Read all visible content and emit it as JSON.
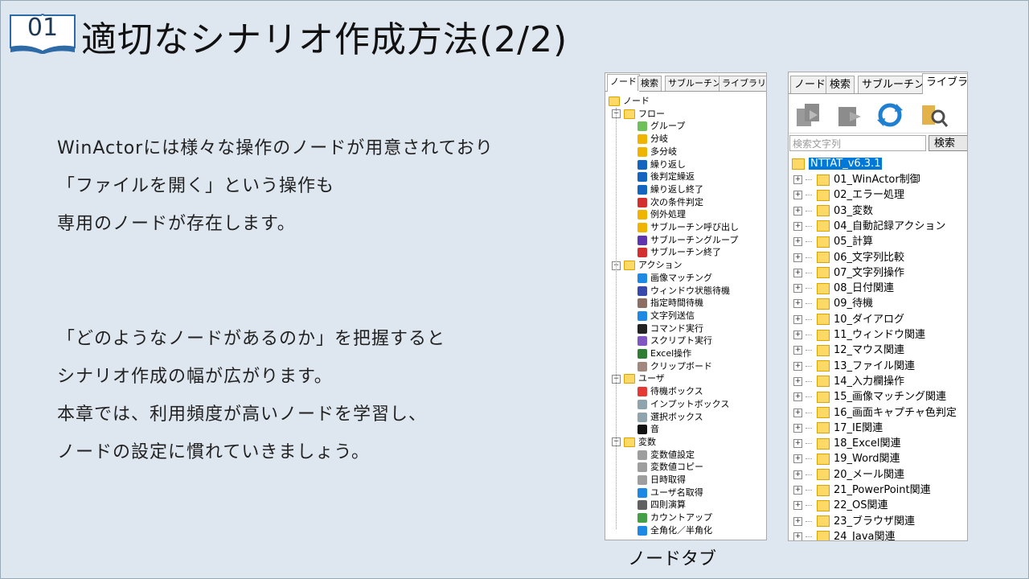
{
  "badge": {
    "number": "01"
  },
  "title": "適切なシナリオ作成方法(2/2)",
  "para1": [
    "WinActorには様々な操作のノードが用意されており",
    "「ファイルを開く」という操作も",
    "専用のノードが存在します。"
  ],
  "para2": [
    "「どのようなノードがあるのか」を把握すると",
    "シナリオ作成の幅が広がります。",
    "本章では、利用頻度が高いノードを学習し、",
    "ノードの設定に慣れていきましょう。"
  ],
  "node_panel": {
    "tabs": [
      "ノード",
      "検索",
      "サブルーチン",
      "ライブラリ"
    ],
    "root": "ノード",
    "groups": [
      {
        "label": "フロー",
        "items": [
          "グループ",
          "分岐",
          "多分岐",
          "繰り返し",
          "後判定繰返",
          "繰り返し終了",
          "次の条件判定",
          "例外処理",
          "サブルーチン呼び出し",
          "サブルーチングループ",
          "サブルーチン終了"
        ]
      },
      {
        "label": "アクション",
        "items": [
          "画像マッチング",
          "ウィンドウ状態待機",
          "指定時間待機",
          "文字列送信",
          "コマンド実行",
          "スクリプト実行",
          "Excel操作",
          "クリップボード"
        ]
      },
      {
        "label": "ユーザ",
        "items": [
          "待機ボックス",
          "インプットボックス",
          "選択ボックス",
          "音"
        ]
      },
      {
        "label": "変数",
        "items": [
          "変数値設定",
          "変数値コピー",
          "日時取得",
          "ユーザ名取得",
          "四則演算",
          "カウントアップ",
          "全角化／半角化"
        ]
      }
    ]
  },
  "library_panel": {
    "tabs": [
      "ノード",
      "検索",
      "サブルーチン",
      "ライブラリ"
    ],
    "search_placeholder": "検索文字列",
    "search_button": "検索",
    "root": "NTTAT_v6.3.1",
    "items": [
      "01_WinActor制御",
      "02_エラー処理",
      "03_変数",
      "04_自動記録アクション",
      "05_計算",
      "06_文字列比較",
      "07_文字列操作",
      "08_日付関連",
      "09_待機",
      "10_ダイアログ",
      "11_ウィンドウ関連",
      "12_マウス関連",
      "13_ファイル関連",
      "14_入力欄操作",
      "15_画像マッチング関連",
      "16_画面キャプチャ色判定",
      "17_IE関連",
      "18_Excel関連",
      "19_Word関連",
      "20_メール関連",
      "21_PowerPoint関連",
      "22_OS関連",
      "23_ブラウザ関連",
      "24_Java関連"
    ]
  },
  "caption": "ノードタブ",
  "colors": {
    "background": "#dee6ef",
    "selected": "#0078d7",
    "folder": "#ffd966"
  }
}
